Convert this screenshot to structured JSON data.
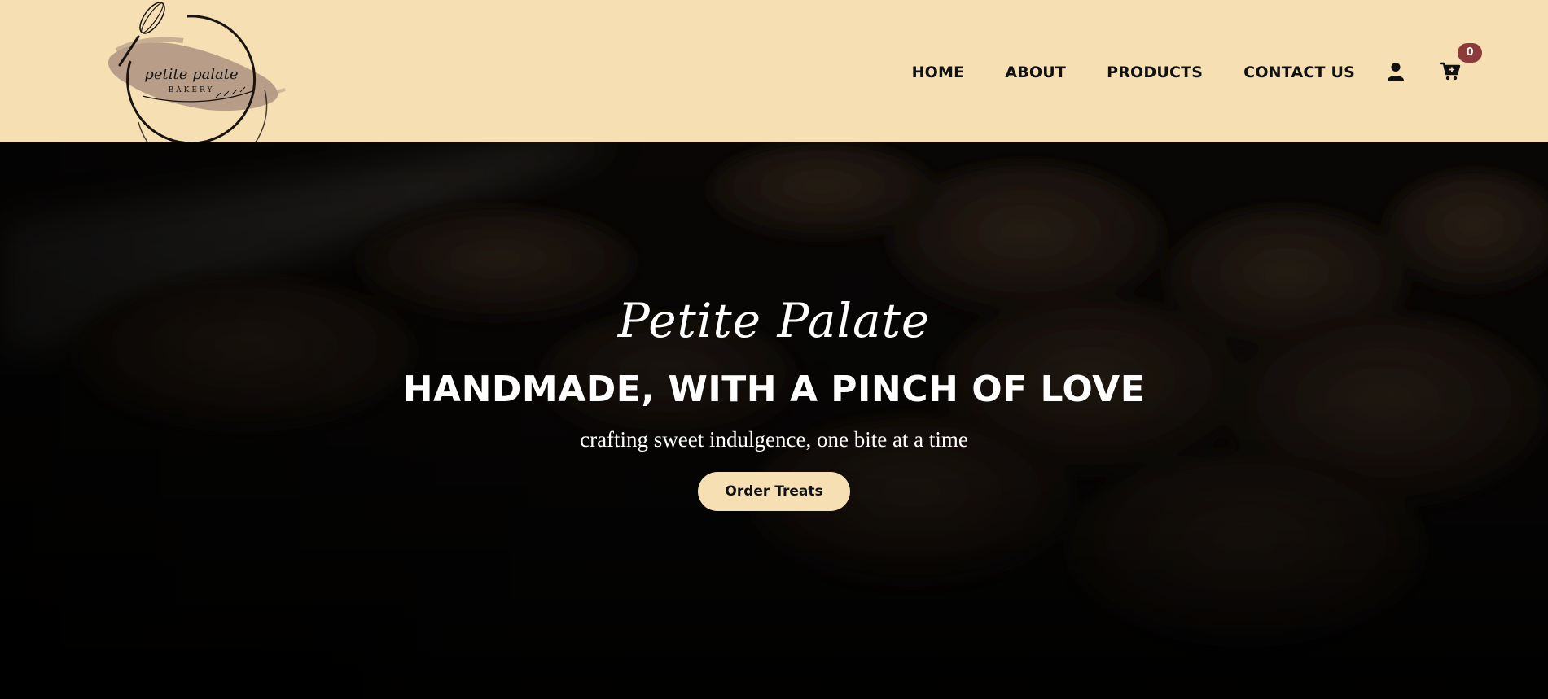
{
  "header": {
    "background": "#f6dfb3",
    "logo": {
      "brand_text": "petite palate",
      "sub_text": "BAKERY"
    },
    "nav": [
      {
        "label": "HOME"
      },
      {
        "label": "ABOUT"
      },
      {
        "label": "PRODUCTS"
      },
      {
        "label": "CONTACT US"
      }
    ],
    "icons": {
      "account": "user-icon",
      "cart": "cart-icon"
    },
    "cart_count": "0",
    "badge_color": "#8c3b3a"
  },
  "hero": {
    "brand": "Petite Palate",
    "headline": "HANDMADE, WITH A PINCH OF LOVE",
    "tagline": "crafting sweet indulgence, one bite at a time",
    "cta_label": "Order Treats",
    "cta_color": "#f6dfb3"
  }
}
